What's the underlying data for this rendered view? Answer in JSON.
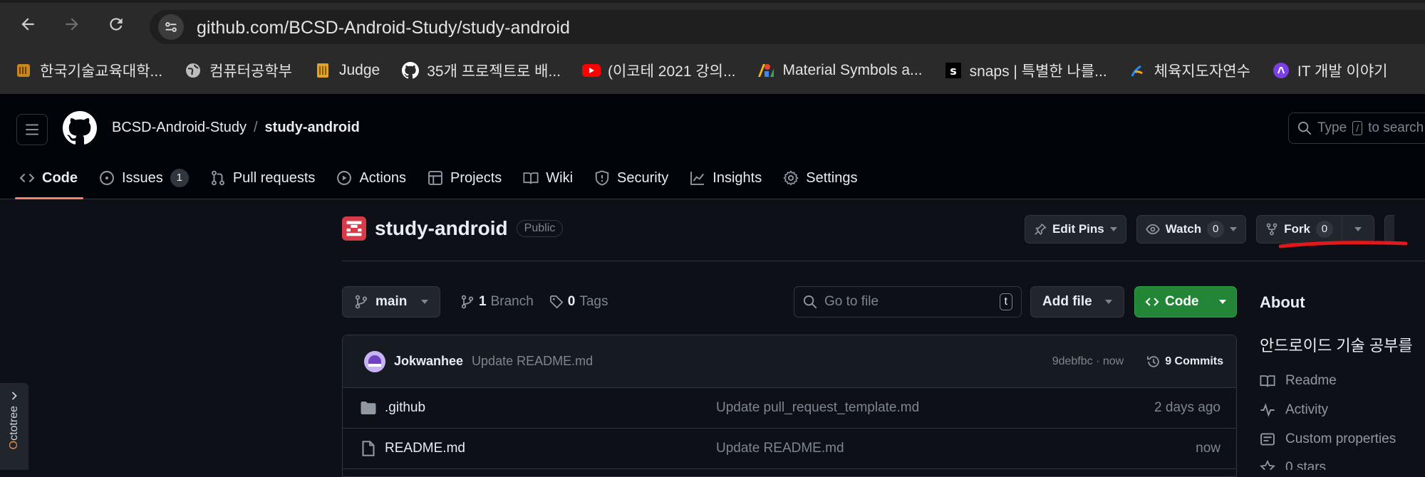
{
  "browser": {
    "url": "github.com/BCSD-Android-Study/study-android",
    "bookmarks": [
      {
        "label": "한국기술교육대학...",
        "icon": "koreatech-icon",
        "color": "#c8861c"
      },
      {
        "label": "컴퓨터공학부",
        "icon": "globe-icon",
        "color": "#bdbdbd"
      },
      {
        "label": "Judge",
        "icon": "judge-icon",
        "color": "#e0a22a"
      },
      {
        "label": "35개 프로젝트로 배...",
        "icon": "github-icon",
        "color": "#ffffff"
      },
      {
        "label": "(이코테 2021 강의...",
        "icon": "youtube-icon",
        "color": "#ff0000"
      },
      {
        "label": "Material Symbols a...",
        "icon": "google-fonts-icon",
        "color": "#4285f4"
      },
      {
        "label": "snaps | 특별한 나를...",
        "icon": "snaps-icon",
        "color": "#111111"
      },
      {
        "label": "체육지도자연수",
        "icon": "sports-icon",
        "color": "#f5a623"
      },
      {
        "label": "IT 개발 이야기",
        "icon": "it-dev-icon",
        "color": "#7b3fe4"
      }
    ]
  },
  "header": {
    "owner": "BCSD-Android-Study",
    "separator": "/",
    "repo": "study-android",
    "search_placeholder_prefix": "Type",
    "search_key": "/",
    "search_placeholder_suffix": "to search"
  },
  "tabs": [
    {
      "label": "Code",
      "icon": "code-icon",
      "active": true
    },
    {
      "label": "Issues",
      "icon": "issue-icon",
      "count": "1"
    },
    {
      "label": "Pull requests",
      "icon": "pull-request-icon"
    },
    {
      "label": "Actions",
      "icon": "play-icon"
    },
    {
      "label": "Projects",
      "icon": "table-icon"
    },
    {
      "label": "Wiki",
      "icon": "book-icon"
    },
    {
      "label": "Security",
      "icon": "shield-icon"
    },
    {
      "label": "Insights",
      "icon": "graph-icon"
    },
    {
      "label": "Settings",
      "icon": "gear-icon"
    }
  ],
  "repo": {
    "name": "study-android",
    "visibility": "Public",
    "edit_pins": "Edit Pins",
    "watch": "Watch",
    "watch_count": "0",
    "fork": "Fork",
    "fork_count": "0"
  },
  "toolbar": {
    "branch": "main",
    "branch_count": "1",
    "branch_label": "Branch",
    "tag_count": "0",
    "tag_label": "Tags",
    "goto_placeholder": "Go to file",
    "goto_key": "t",
    "add_file": "Add file",
    "code": "Code"
  },
  "commit": {
    "author": "Jokwanhee",
    "message": "Update README.md",
    "hash_time": "9debfbc · now",
    "commits": "9 Commits"
  },
  "files": [
    {
      "name": ".github",
      "type": "folder",
      "commit": "Update pull_request_template.md",
      "time": "2 days ago"
    },
    {
      "name": "README.md",
      "type": "file",
      "commit": "Update README.md",
      "time": "now"
    }
  ],
  "about": {
    "title": "About",
    "description": "안드로이드 기술 공부를",
    "links": [
      {
        "label": "Readme",
        "icon": "book-icon"
      },
      {
        "label": "Activity",
        "icon": "pulse-icon"
      },
      {
        "label": "Custom properties",
        "icon": "note-icon"
      },
      {
        "label": "0 stars",
        "icon": "star-icon"
      }
    ]
  },
  "octotree": {
    "label_first": "O",
    "label_rest": "ctotree"
  },
  "colors": {
    "accent_underline": "#f78166",
    "code_button": "#238636",
    "annotation": "#e5171b"
  }
}
